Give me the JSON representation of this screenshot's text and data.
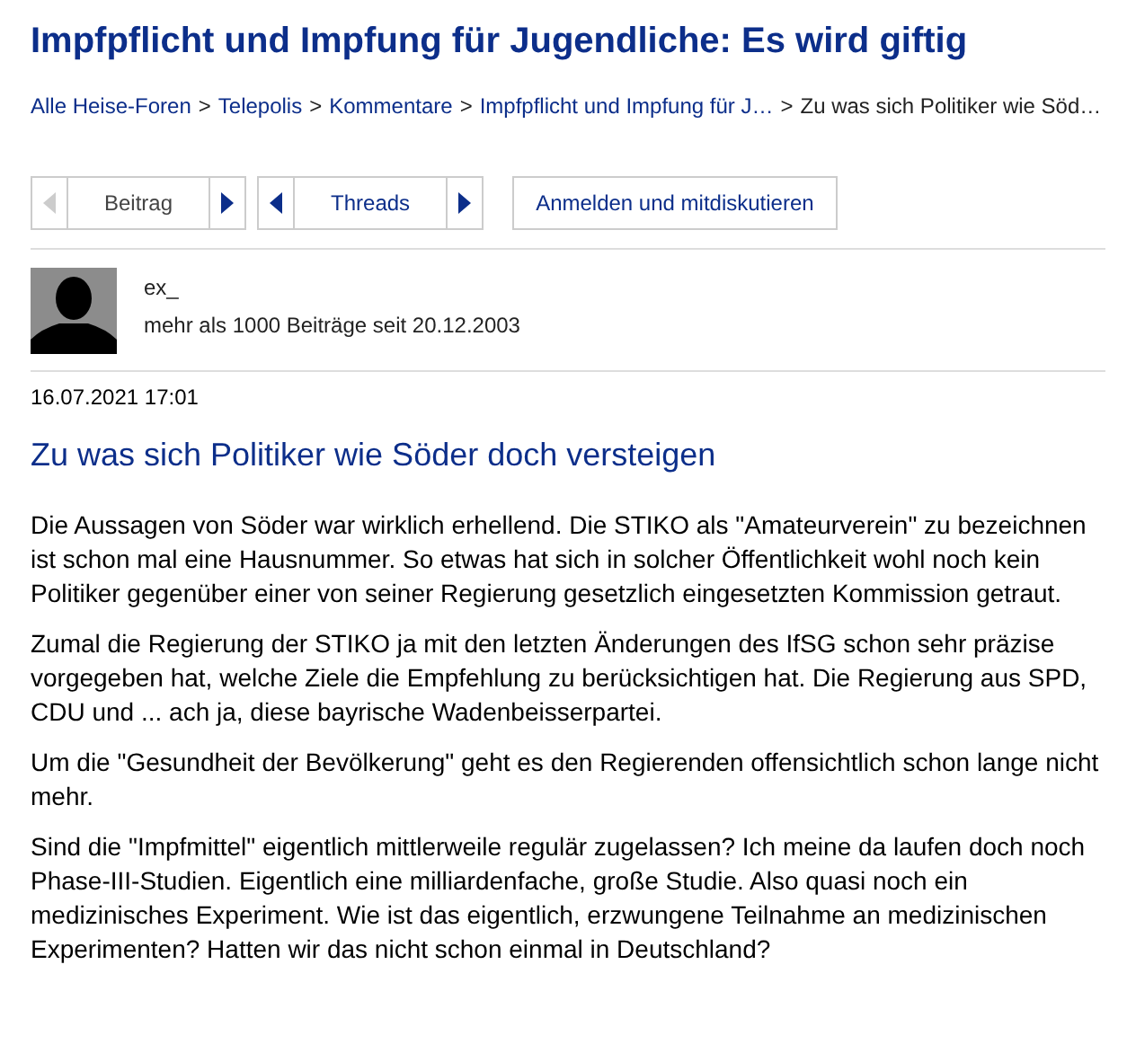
{
  "thread_title": "Impfpflicht und Impfung für Jugendliche: Es wird giftig",
  "breadcrumb": [
    {
      "label": "Alle Heise-Foren",
      "current": false
    },
    {
      "label": "Telepolis",
      "current": false
    },
    {
      "label": "Kommentare",
      "current": false
    },
    {
      "label": "Impfpflicht und Impfung für J…",
      "current": false
    },
    {
      "label": "Zu was sich Politiker wie Söd…",
      "current": true
    }
  ],
  "breadcrumb_separator": ">",
  "navigation": [
    {
      "label": "Beitrag",
      "prev_disabled": true,
      "next_disabled": false
    },
    {
      "label": "Threads",
      "prev_disabled": false,
      "next_disabled": false
    }
  ],
  "login_button": "Anmelden und mitdiskutieren",
  "author": {
    "name": "ex_",
    "info": "mehr als 1000 Beiträge seit 20.12.2003"
  },
  "timestamp": "16.07.2021 17:01",
  "post_title": "Zu was sich Politiker wie Söder doch versteigen",
  "paragraphs": [
    "Die Aussagen von Söder war wirklich erhellend. Die STIKO als \"Amateurverein\" zu bezeichnen ist schon mal eine Hausnummer. So etwas hat sich in solcher Öffentlichkeit wohl noch kein Politiker gegenüber einer von seiner Regierung gesetzlich eingesetzten Kommission getraut.",
    "Zumal die Regierung der STIKO ja mit den letzten Änderungen des IfSG schon sehr präzise vorgegeben hat, welche Ziele die Empfehlung zu berücksichtigen hat. Die Regierung aus SPD, CDU und ... ach ja, diese bayrische Wadenbeisserpartei.",
    "Um die \"Gesundheit der Bevölkerung\" geht es den Regierenden offensichtlich schon lange nicht mehr.",
    "Sind die \"Impfmittel\" eigentlich mittlerweile regulär zugelassen? Ich meine da laufen doch noch Phase-III-Studien. Eigentlich eine milliardenfache, große Studie. Also quasi noch ein medizinisches Experiment. Wie ist das eigentlich, erzwungene Teilnahme an medizinischen Experimenten? Hatten wir das nicht schon einmal in Deutschland?"
  ]
}
